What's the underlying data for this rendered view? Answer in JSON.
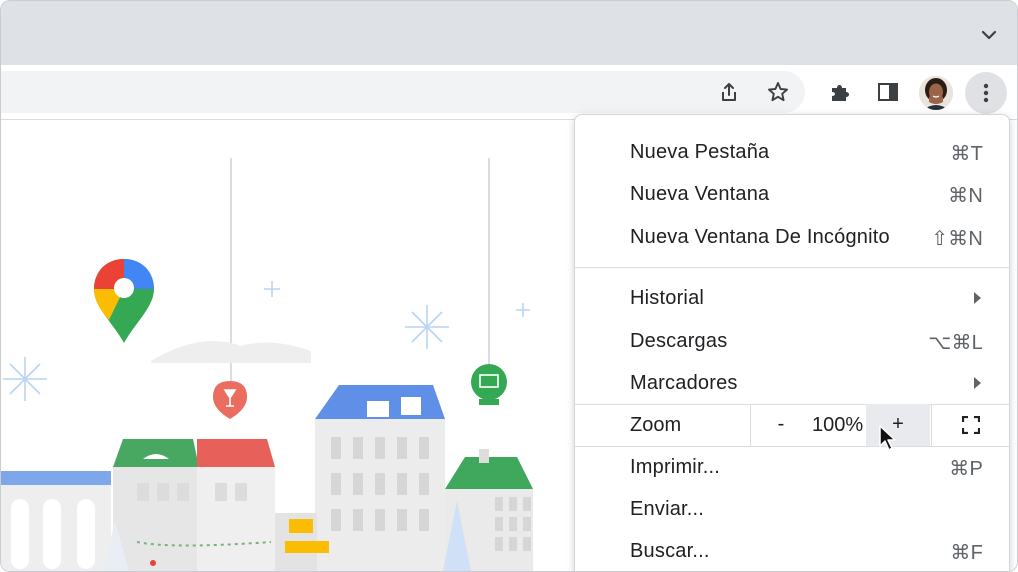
{
  "toolbar": {
    "share_icon": "share-icon",
    "bookmark_icon": "star-icon",
    "extensions_icon": "puzzle-icon",
    "side_panel_icon": "side-panel-icon",
    "menu_icon": "three-dot-menu-icon"
  },
  "menu": {
    "items": [
      {
        "label": "Nueva Pestaña",
        "shortcut": "⌘T"
      },
      {
        "label": "Nueva Ventana",
        "shortcut": "⌘N"
      },
      {
        "label": "Nueva Ventana De Incógnito",
        "shortcut": "⇧⌘N"
      },
      {
        "label": "Historial",
        "shortcut": ""
      },
      {
        "label": "Descargas",
        "shortcut": "⌥⌘L"
      },
      {
        "label": "Marcadores",
        "shortcut": ""
      },
      {
        "label": "Imprimir...",
        "shortcut": "⌘P"
      },
      {
        "label": "Enviar...",
        "shortcut": ""
      },
      {
        "label": "Buscar...",
        "shortcut": "⌘F"
      }
    ],
    "zoom": {
      "label": "Zoom",
      "minus": "-",
      "value": "100%",
      "plus": "+"
    }
  },
  "colors": {
    "tabstrip": "#dee1e6",
    "omnibox": "#f1f3f4",
    "maps_blue": "#4285f4",
    "maps_red": "#ea4335",
    "maps_yellow": "#fbbc04",
    "maps_green": "#34a853"
  }
}
